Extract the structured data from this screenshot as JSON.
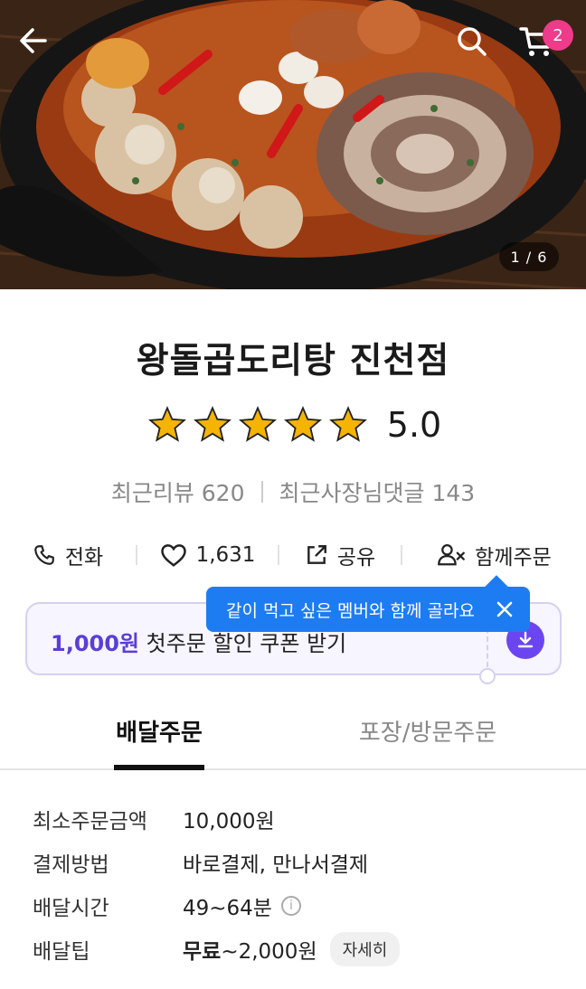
{
  "hero": {
    "image_counter": "1 / 6",
    "cart_badge": "2"
  },
  "store": {
    "name": "왕돌곱도리탕 진천점",
    "rating": "5.0",
    "stars_filled": 5,
    "recent_reviews_label": "최근리뷰 620",
    "owner_replies_label": "최근사장님댓글 143"
  },
  "actions": {
    "call_label": "전화",
    "like_count": "1,631",
    "share_label": "공유",
    "group_order_label": "함께주문"
  },
  "tooltip": {
    "text": "같이 먹고 싶은 멤버와 함께 골라요"
  },
  "coupon": {
    "amount": "1,000원",
    "text": " 첫주문 할인 쿠폰 받기"
  },
  "tabs": {
    "delivery": "배달주문",
    "pickup": "포장/방문주문"
  },
  "info": {
    "min_order_label": "최소주문금액",
    "min_order_value": "10,000원",
    "payment_label": "결제방법",
    "payment_value": "바로결제, 만나서결제",
    "delivery_time_label": "배달시간",
    "delivery_time_value": "49~64분",
    "delivery_tip_label": "배달팁",
    "delivery_tip_free": "무료",
    "delivery_tip_range": "~2,000원",
    "detail_button": "자세히"
  },
  "colors": {
    "accent_purple": "#6b46f0",
    "tooltip_blue": "#1e7cf2",
    "badge_pink": "#ee3b8a",
    "star_gold": "#f5b400"
  }
}
